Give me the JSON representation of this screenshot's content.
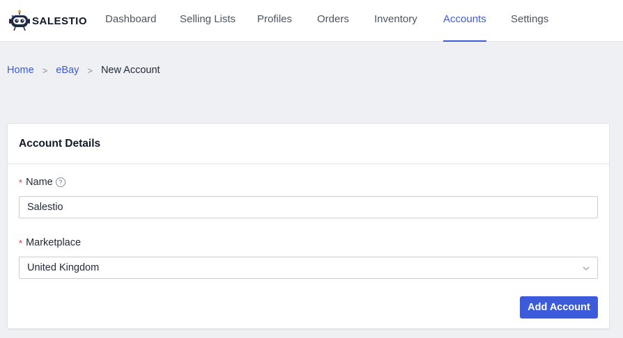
{
  "brand": {
    "name": "SALESTIO"
  },
  "nav": {
    "items": [
      {
        "label": "Dashboard"
      },
      {
        "label": "Selling Lists"
      },
      {
        "label": "Profiles"
      },
      {
        "label": "Orders"
      },
      {
        "label": "Inventory"
      },
      {
        "label": "Accounts",
        "active": true
      },
      {
        "label": "Settings"
      }
    ]
  },
  "breadcrumb": {
    "home": "Home",
    "section": "eBay",
    "current": "New Account",
    "separator": ">"
  },
  "form": {
    "title": "Account Details",
    "required_mark": "*",
    "name": {
      "label": "Name",
      "value": "Salestio",
      "help_icon": "question-circle-icon"
    },
    "marketplace": {
      "label": "Marketplace",
      "value": "United Kingdom",
      "icon": "chevron-down-icon"
    },
    "submit_label": "Add Account"
  },
  "colors": {
    "accent": "#3b5bdb",
    "required": "#d9342b",
    "page_bg": "#eef0f3"
  }
}
